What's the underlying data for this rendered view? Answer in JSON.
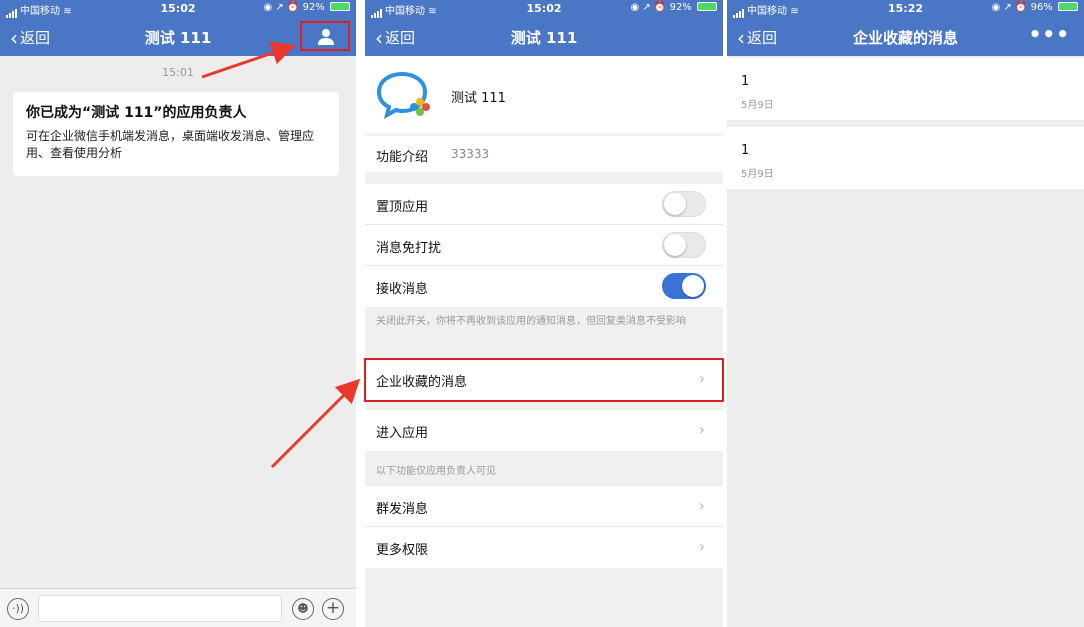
{
  "panel1": {
    "status": {
      "carrier": "中国移动",
      "time": "15:02",
      "battery": "92%"
    },
    "nav": {
      "back": "返回",
      "title": "测试 111"
    },
    "timestamp": "15:01",
    "card": {
      "title": "你已成为“测试 111”的应用负责人",
      "body": "可在企业微信手机端发消息，桌面端收发消息、管理应用、查看使用分析"
    }
  },
  "panel2": {
    "status": {
      "carrier": "中国移动",
      "time": "15:02",
      "battery": "92%"
    },
    "nav": {
      "back": "返回",
      "title": "测试 111"
    },
    "app_name": "测试 111",
    "intro": {
      "label": "功能介绍",
      "value": "33333"
    },
    "toggles": [
      {
        "label": "置顶应用",
        "on": false
      },
      {
        "label": "消息免打扰",
        "on": false
      },
      {
        "label": "接收消息",
        "on": true
      }
    ],
    "toggle_note": "关闭此开关，你将不再收到该应用的通知消息，但回复类消息不受影响",
    "collected": "企业收藏的消息",
    "enter_app": "进入应用",
    "owner_note": "以下功能仅应用负责人可见",
    "owner_items": [
      "群发消息",
      "更多权限"
    ]
  },
  "panel3": {
    "status": {
      "carrier": "中国移动",
      "time": "15:22",
      "battery": "96%"
    },
    "nav": {
      "back": "返回",
      "title": "企业收藏的消息",
      "more": "•••"
    },
    "messages": [
      {
        "value": "1",
        "date": "5月9日"
      },
      {
        "value": "1",
        "date": "5月9日"
      }
    ]
  },
  "colors": {
    "nav": "#4a77c5",
    "highlight": "#e02020",
    "toggle_on": "#3a73d8"
  },
  "icons": [
    "signal-icon",
    "wifi-icon",
    "battery-icon",
    "back-chevron-icon",
    "person-icon",
    "voice-icon",
    "emoji-icon",
    "plus-icon",
    "app-logo-icon",
    "chevron-right-icon",
    "more-icon"
  ]
}
